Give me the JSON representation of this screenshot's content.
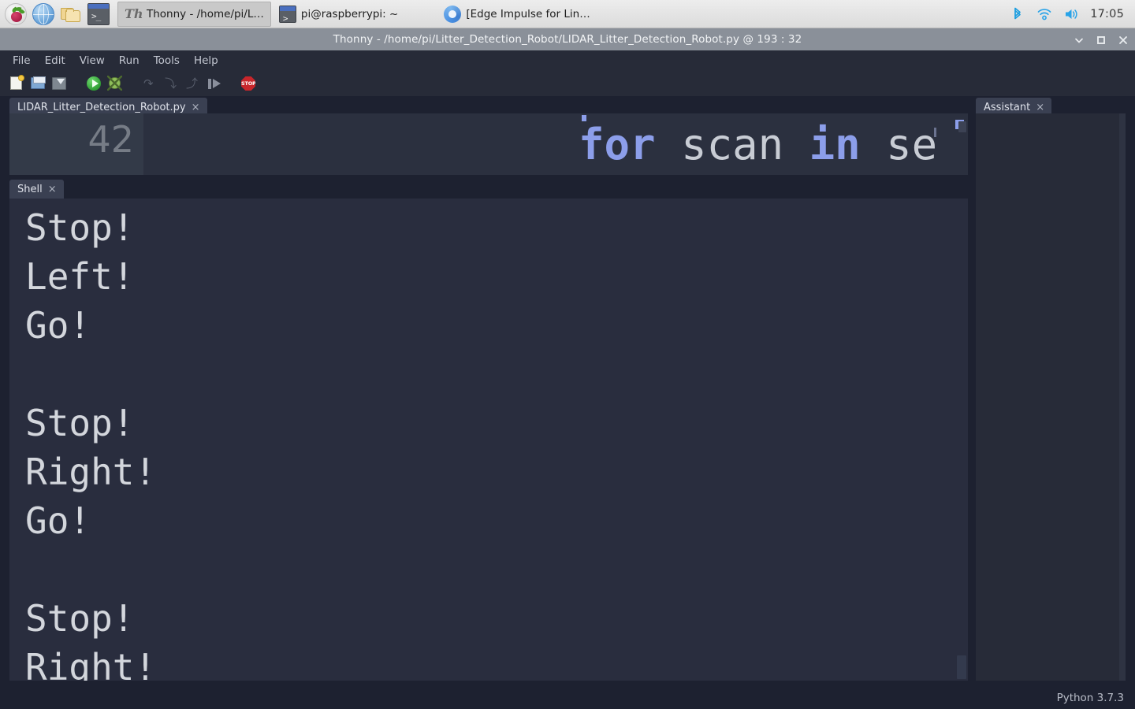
{
  "taskbar": {
    "launchers": [
      {
        "name": "raspberry-menu-icon",
        "label": "Raspberry Pi Menu"
      },
      {
        "name": "web-browser-icon",
        "label": "Web Browser"
      },
      {
        "name": "file-manager-icon",
        "label": "File Manager"
      },
      {
        "name": "terminal-icon",
        "label": "Terminal"
      }
    ],
    "windows": [
      {
        "label": "Thonny  -  /home/pi/L…",
        "icon": "thonny-icon",
        "active": true
      },
      {
        "label": "pi@raspberrypi: ~",
        "icon": "terminal-icon",
        "active": false
      },
      {
        "label": "[Edge Impulse for Lin…",
        "icon": "chromium-icon",
        "active": false
      }
    ],
    "tray": {
      "bluetooth": "bluetooth-icon",
      "wifi": "wifi-icon",
      "volume": "volume-icon",
      "clock": "17:05"
    }
  },
  "window": {
    "title_app": "Thonny",
    "title_sep": "-",
    "title_path": "/home/pi/Litter_Detection_Robot/LIDAR_Litter_Detection_Robot.py",
    "title_at": "@",
    "title_position": "193 : 32",
    "title_full": "Thonny  -  /home/pi/Litter_Detection_Robot/LIDAR_Litter_Detection_Robot.py  @  193 : 32",
    "controls": {
      "minimize": "minimize-button",
      "maximize": "maximize-button",
      "close": "close-button"
    }
  },
  "menubar": {
    "items": [
      {
        "label": "File"
      },
      {
        "label": "Edit"
      },
      {
        "label": "View"
      },
      {
        "label": "Run"
      },
      {
        "label": "Tools"
      },
      {
        "label": "Help"
      }
    ]
  },
  "toolbar": {
    "buttons": [
      {
        "name": "new-file-button",
        "icon": "new-file-icon",
        "label": "New"
      },
      {
        "name": "open-file-button",
        "icon": "open-folder-icon",
        "label": "Open"
      },
      {
        "name": "save-file-button",
        "icon": "save-disk-icon",
        "label": "Save"
      },
      {
        "name": "run-button",
        "icon": "run-play-icon",
        "label": "Run current script"
      },
      {
        "name": "debug-button",
        "icon": "debug-bug-icon",
        "label": "Debug current script"
      },
      {
        "name": "step-over-button",
        "icon": "step-over-arrow-icon",
        "label": "Step over"
      },
      {
        "name": "step-into-button",
        "icon": "step-into-arrow-icon",
        "label": "Step into"
      },
      {
        "name": "step-out-button",
        "icon": "step-out-arrow-icon",
        "label": "Step out"
      },
      {
        "name": "resume-button",
        "icon": "resume-arrow-icon",
        "label": "Resume"
      },
      {
        "name": "stop-button",
        "icon": "stop-sign-icon",
        "label": "STOP"
      }
    ],
    "stop_text": "STOP"
  },
  "editor": {
    "tab_label": "LIDAR_Litter_Detection_Robot.py",
    "tab_close": "×",
    "line_number": "42",
    "code_tokens": [
      {
        "text": "for",
        "type": "keyword"
      },
      {
        "text": " ",
        "type": "plain"
      },
      {
        "text": "scan",
        "type": "identifier"
      },
      {
        "text": " ",
        "type": "plain"
      },
      {
        "text": "in",
        "type": "keyword"
      },
      {
        "text": " ",
        "type": "plain"
      },
      {
        "text": "se",
        "type": "identifier"
      }
    ],
    "code_visible": "for scan in se"
  },
  "shell": {
    "tab_label": "Shell",
    "tab_close": "×",
    "output_lines": [
      "Stop!",
      "Left!",
      "Go!",
      "",
      "Stop!",
      "Right!",
      "Go!",
      "",
      "Stop!",
      "Right!"
    ],
    "output_text": "Stop!\nLeft!\nGo!\n\nStop!\nRight!\nGo!\n\nStop!\nRight!"
  },
  "assistant": {
    "tab_label": "Assistant",
    "tab_close": "×",
    "body": ""
  },
  "statusbar": {
    "interpreter": "Python 3.7.3"
  },
  "colors": {
    "taskbar_bg": "#e4e4e4",
    "titlebar_bg": "#8a9099",
    "window_bg": "#272b38",
    "editor_bg": "#2b303f",
    "gutter_bg": "#333a48",
    "shell_bg": "#292d3e",
    "keyword": "#8c9eea",
    "identifier": "#c8ccd4",
    "shell_text": "#d3d6dc",
    "tray_icon": "#29a3e8",
    "stop_red": "#c8262b",
    "run_green": "#2f9e34"
  }
}
